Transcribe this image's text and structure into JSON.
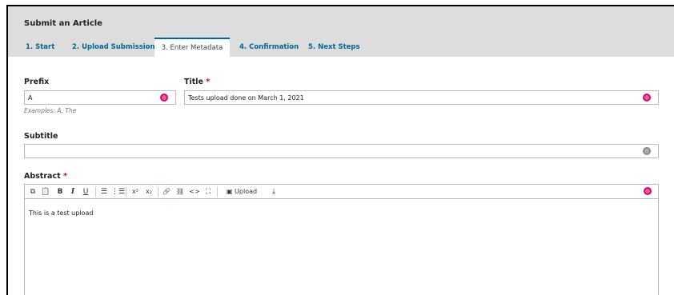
{
  "header": {
    "title": "Submit an Article"
  },
  "tabs": [
    {
      "label": "1. Start"
    },
    {
      "label": "2. Upload Submission"
    },
    {
      "label": "3. Enter Metadata"
    },
    {
      "label": "4. Confirmation"
    },
    {
      "label": "5. Next Steps"
    }
  ],
  "form": {
    "prefix": {
      "label": "Prefix",
      "value": "A",
      "hint": "Examples: A, The"
    },
    "title": {
      "label": "Title",
      "required_mark": "*",
      "value": "Tests upload done on March 1, 2021"
    },
    "subtitle": {
      "label": "Subtitle",
      "value": ""
    },
    "abstract": {
      "label": "Abstract",
      "required_mark": "*",
      "content": "This is a test upload"
    }
  },
  "toolbar": {
    "copy_icon": "⧉",
    "paste_icon": "📋",
    "bold_label": "B",
    "italic_label": "I",
    "underline_label": "U",
    "bullet_list_icon": "☰",
    "numbered_list_icon": "⋮☰",
    "superscript_label": "x²",
    "subscript_label": "x₂",
    "link_icon": "🔗",
    "unlink_icon": "⛓",
    "code_icon": "<>",
    "fullscreen_icon": "⛶",
    "image_icon": "▣",
    "upload_label": "Upload",
    "download_icon": "⤓"
  },
  "colors": {
    "accent": "#006798",
    "required": "#dd0000",
    "globe_active": "#d00a6c",
    "globe_inactive": "#888888",
    "header_bg": "#dddddd"
  }
}
